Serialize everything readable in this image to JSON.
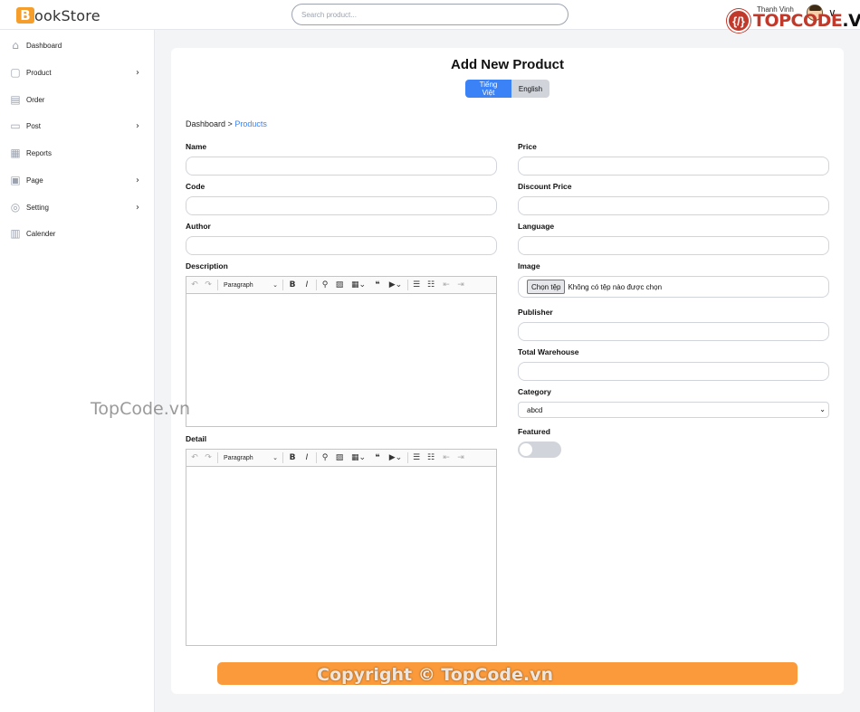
{
  "header": {
    "logo_letter": "B",
    "logo_text": "ookStore",
    "search_placeholder": "Search product...",
    "brand_text": "TOPCODE",
    "brand_suffix": ".VN",
    "user_name": "Thanh Vinh"
  },
  "sidebar": {
    "items": [
      {
        "label": "Dashboard",
        "icon": "home-icon",
        "glyph": "⌂",
        "has_children": false
      },
      {
        "label": "Product",
        "icon": "cube-icon",
        "glyph": "▢",
        "has_children": true
      },
      {
        "label": "Order",
        "icon": "clipboard-icon",
        "glyph": "▤",
        "has_children": false
      },
      {
        "label": "Post",
        "icon": "note-icon",
        "glyph": "▭",
        "has_children": true
      },
      {
        "label": "Reports",
        "icon": "report-icon",
        "glyph": "▦",
        "has_children": false
      },
      {
        "label": "Page",
        "icon": "page-icon",
        "glyph": "▣",
        "has_children": true
      },
      {
        "label": "Setting",
        "icon": "gear-icon",
        "glyph": "◎",
        "has_children": true
      },
      {
        "label": "Calender",
        "icon": "calendar-icon",
        "glyph": "▥",
        "has_children": false
      }
    ]
  },
  "main": {
    "title": "Add New Product",
    "lang_vi": "Tiếng Việt",
    "lang_en": "English",
    "breadcrumb_root": "Dashboard >",
    "breadcrumb_current": "Products",
    "fields": {
      "name": "Name",
      "code": "Code",
      "author": "Author",
      "description": "Description",
      "detail": "Detail",
      "price": "Price",
      "discount_price": "Discount Price",
      "language": "Language",
      "image": "Image",
      "publisher": "Publisher",
      "total_warehouse": "Total Warehouse",
      "category": "Category",
      "featured": "Featured"
    },
    "file_button": "Chọn tệp",
    "file_status": "Không có tệp nào được chọn",
    "category_value": "abcd",
    "featured_on": false,
    "editor_paragraph": "Paragraph",
    "submit_label": ""
  },
  "watermarks": {
    "top": "TopCode.vn",
    "bottom": "Copyright © TopCode.vn"
  },
  "colors": {
    "accent": "#3b82f6",
    "submit": "#fb9a3a",
    "logo": "#f59e2b",
    "brand": "#c0392b"
  }
}
